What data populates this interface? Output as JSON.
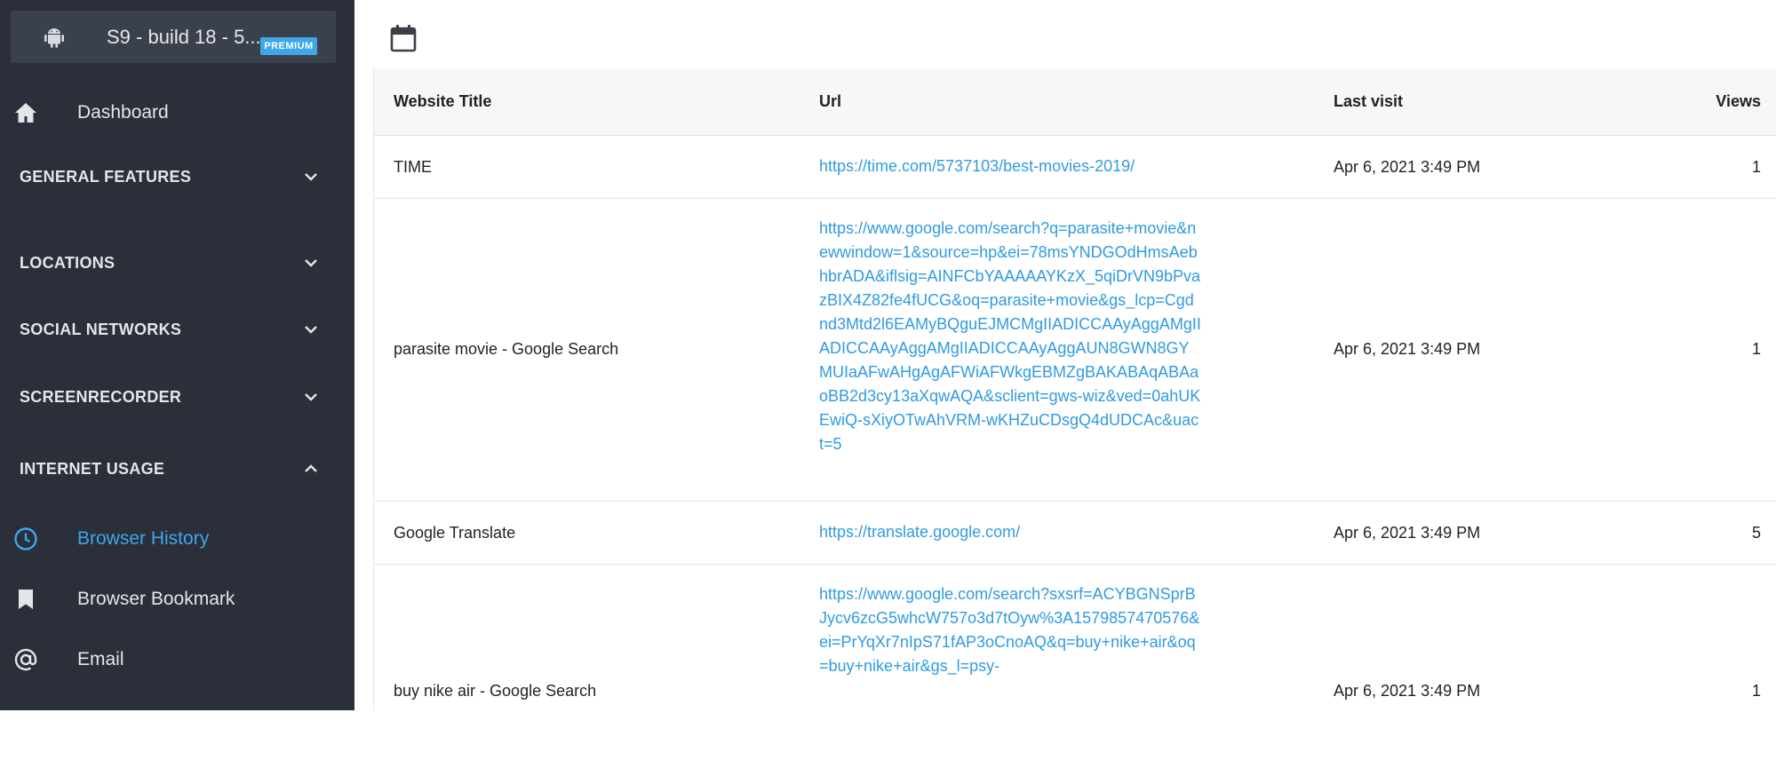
{
  "device": {
    "name": "S9 - build 18 - 5....",
    "badge": "PREMIUM"
  },
  "nav": {
    "dashboard": "Dashboard",
    "sections": {
      "general": "GENERAL FEATURES",
      "locations": "LOCATIONS",
      "social": "SOCIAL NETWORKS",
      "screen": "SCREENRECORDER",
      "internet": "INTERNET USAGE"
    },
    "items": {
      "browser_history": "Browser History",
      "browser_bookmark": "Browser Bookmark",
      "email": "Email"
    }
  },
  "colors": {
    "sidebar_bg": "#2a2f3a",
    "accent": "#3ea7ea",
    "link": "#2f9be0"
  },
  "table": {
    "headers": {
      "title": "Website Title",
      "url": "Url",
      "last_visit": "Last visit",
      "views": "Views"
    },
    "rows": [
      {
        "title": "TIME",
        "url": "https://time.com/5737103/best-movies-2019/",
        "last_visit": "Apr 6, 2021 3:49 PM",
        "views": "1"
      },
      {
        "title": "parasite movie - Google Search",
        "url": "https://www.google.com/search?q=parasite+movie&newwindow=1&source=hp&ei=78msYNDGOdHmsAebhbrADA&iflsig=AINFCbYAAAAAYKzX_5qiDrVN9bPvazBIX4Z82fe4fUCG&oq=parasite+movie&gs_lcp=Cgdnd3Mtd2l6EAMyBQguEJMCMgIIADICCAAyAggAMgIIADICCAAyAggAMgIIADICCAAyAggAUN8GWN8GYMUIaAFwAHgAgAFWiAFWkgEBMZgBAKABAqABAaoBB2d3cy13aXqwAQA&sclient=gws-wiz&ved=0ahUKEwiQ-sXiyOTwAhVRM-wKHZuCDsgQ4dUDCAc&uact=5",
        "last_visit": "Apr 6, 2021 3:49 PM",
        "views": "1"
      },
      {
        "title": "Google Translate",
        "url": "https://translate.google.com/",
        "last_visit": "Apr 6, 2021 3:49 PM",
        "views": "5"
      },
      {
        "title": "buy nike air - Google Search",
        "url": "https://www.google.com/search?sxsrf=ACYBGNSprBJycv6zcG5whcW757o3d7tOyw%3A1579857470576&ei=PrYqXr7nIpS71fAP3oCnoAQ&q=buy+nike+air&oq=buy+nike+air&gs_l=psy-",
        "last_visit": "Apr 6, 2021 3:49 PM",
        "views": "1"
      }
    ]
  }
}
